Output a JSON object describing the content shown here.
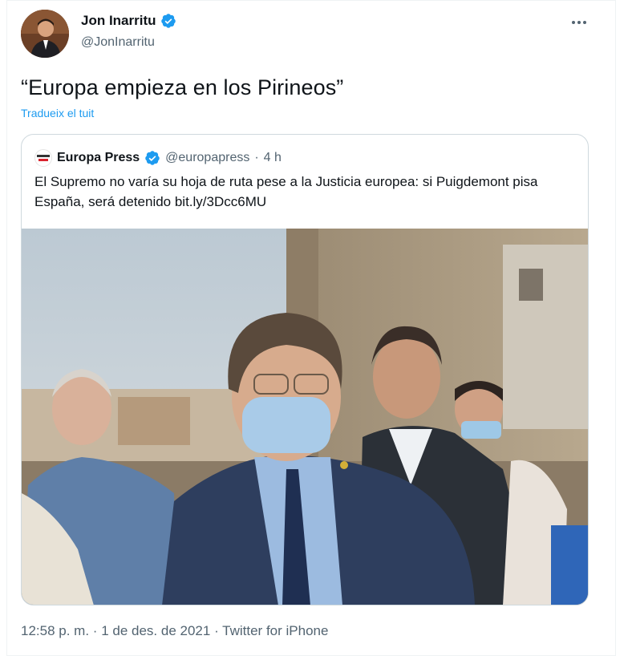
{
  "author": {
    "name": "Jon Inarritu",
    "handle": "@JonInarritu",
    "avatar_icon": "profile-photo",
    "verified": true
  },
  "tweet": {
    "text": "“Europa empieza en los Pirineos”",
    "translate_link": "Tradueix el tuit"
  },
  "quoted": {
    "name": "Europa Press",
    "handle": "@europapress",
    "separator": "·",
    "time": "4 h",
    "text": "El Supremo no varía su hoja de ruta pese a la Justicia europea: si Puigdemont pisa España, será detenido bit.ly/3Dcc6MU",
    "logo_icon": "europa-press-logo",
    "photo_icon": "news-photo"
  },
  "meta": {
    "time": "12:58 p. m.",
    "sep1": "·",
    "date": "1 de des. de 2021",
    "sep2": "·",
    "source": "Twitter for iPhone"
  },
  "colors": {
    "accent": "#1d9bf0",
    "secondary_text": "#536471",
    "border": "#cfd9de"
  }
}
